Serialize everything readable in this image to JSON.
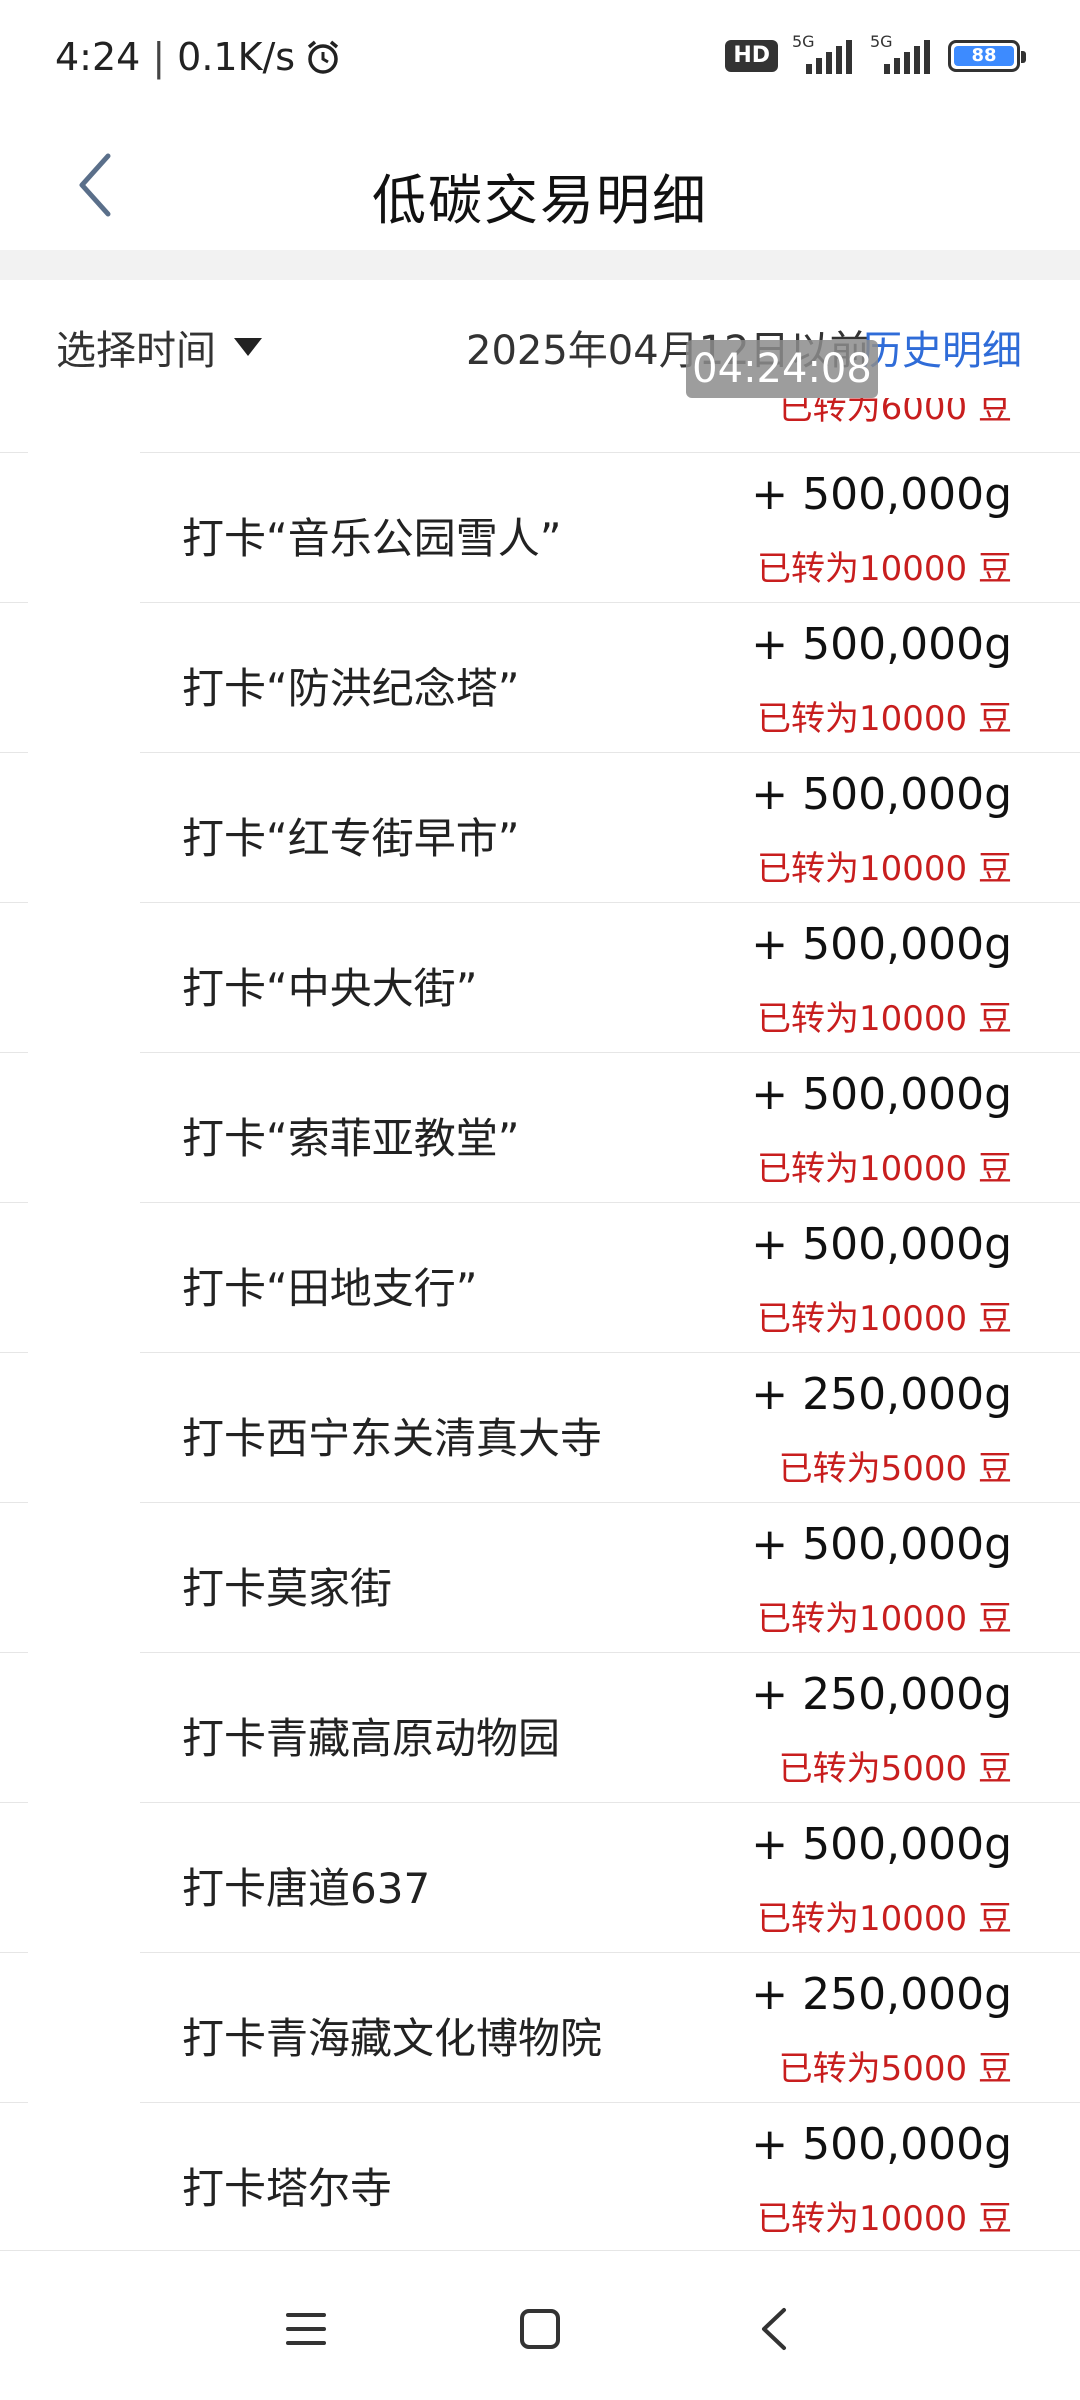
{
  "status_bar": {
    "time": "4:24",
    "network_speed": "0.1K/s",
    "separator": "|",
    "hd_badge": "HD",
    "signal_1_label": "5G",
    "signal_2_label": "5G",
    "battery_level": "88",
    "alarm_icon": "alarm-clock-icon"
  },
  "header": {
    "title": "低碳交易明细",
    "back_icon": "chevron-left-icon"
  },
  "filter": {
    "time_select_label": "选择时间",
    "date_text": "2025年04月12日以前",
    "history_link": "历史明细",
    "overlay_time": "04:24:08"
  },
  "partial_row": {
    "sub": "已转为6000 豆"
  },
  "transactions": [
    {
      "title": "打卡“音乐公园雪人”",
      "amount": "+ 500,000g",
      "sub": "已转为10000 豆"
    },
    {
      "title": "打卡“防洪纪念塔”",
      "amount": "+ 500,000g",
      "sub": "已转为10000 豆"
    },
    {
      "title": "打卡“红专街早市”",
      "amount": "+ 500,000g",
      "sub": "已转为10000 豆"
    },
    {
      "title": "打卡“中央大街”",
      "amount": "+ 500,000g",
      "sub": "已转为10000 豆"
    },
    {
      "title": "打卡“索菲亚教堂”",
      "amount": "+ 500,000g",
      "sub": "已转为10000 豆"
    },
    {
      "title": "打卡“田地支行”",
      "amount": "+ 500,000g",
      "sub": "已转为10000 豆"
    },
    {
      "title": "打卡西宁东关清真大寺",
      "amount": "+ 250,000g",
      "sub": "已转为5000 豆"
    },
    {
      "title": "打卡莫家街",
      "amount": "+ 500,000g",
      "sub": "已转为10000 豆"
    },
    {
      "title": "打卡青藏高原动物园",
      "amount": "+ 250,000g",
      "sub": "已转为5000 豆"
    },
    {
      "title": "打卡唐道637",
      "amount": "+ 500,000g",
      "sub": "已转为10000 豆"
    },
    {
      "title": "打卡青海藏文化博物院",
      "amount": "+ 250,000g",
      "sub": "已转为5000 豆"
    },
    {
      "title": "打卡塔尔寺",
      "amount": "+ 500,000g",
      "sub": "已转为10000 豆"
    }
  ],
  "nav_bar": {
    "menu_icon": "menu-icon",
    "home_icon": "home-square-icon",
    "back_icon": "back-arrow-icon"
  },
  "colors": {
    "accent_blue": "#2f6cd8",
    "converted_red": "#c81e1e",
    "battery_blue": "#3d8bff"
  }
}
